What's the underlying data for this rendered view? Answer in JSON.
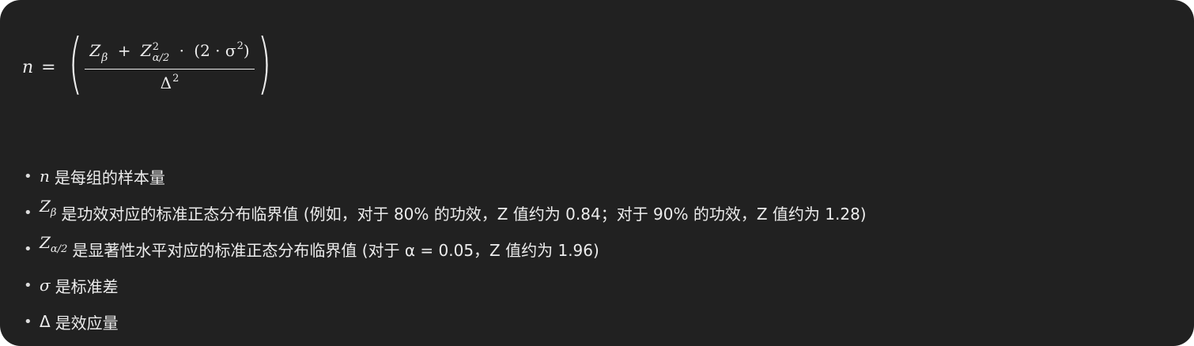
{
  "formula": {
    "lhs": "n",
    "equals": "=",
    "paren_left": "(",
    "paren_right": ")",
    "num_z_beta": "Z",
    "num_beta_sub": "β",
    "num_plus": "+",
    "num_z_alpha": "Z",
    "num_alpha_sup": "2",
    "num_alpha_sub": "α/2",
    "num_cdot": "·",
    "num_group": "(2 · σ",
    "num_sigma_sup": "2",
    "num_close": ")",
    "den_delta": "Δ",
    "den_sup": "2"
  },
  "bullets": [
    {
      "symbol": "n",
      "text": "是每组的样本量"
    },
    {
      "symbol": "Z",
      "symbol_sub": "β",
      "text": "是功效对应的标准正态分布临界值 (例如，对于 80% 的功效，Z 值约为 0.84；对于 90% 的功效，Z 值约为 1.28)"
    },
    {
      "symbol": "Z",
      "symbol_sub": "α/2",
      "text": "是显著性水平对应的标准正态分布临界值 (对于 α = 0.05，Z 值约为 1.96)"
    },
    {
      "symbol": "σ",
      "text": "是标准差"
    },
    {
      "symbol": "Δ",
      "text": "是效应量"
    }
  ],
  "bullet_marker": "•"
}
